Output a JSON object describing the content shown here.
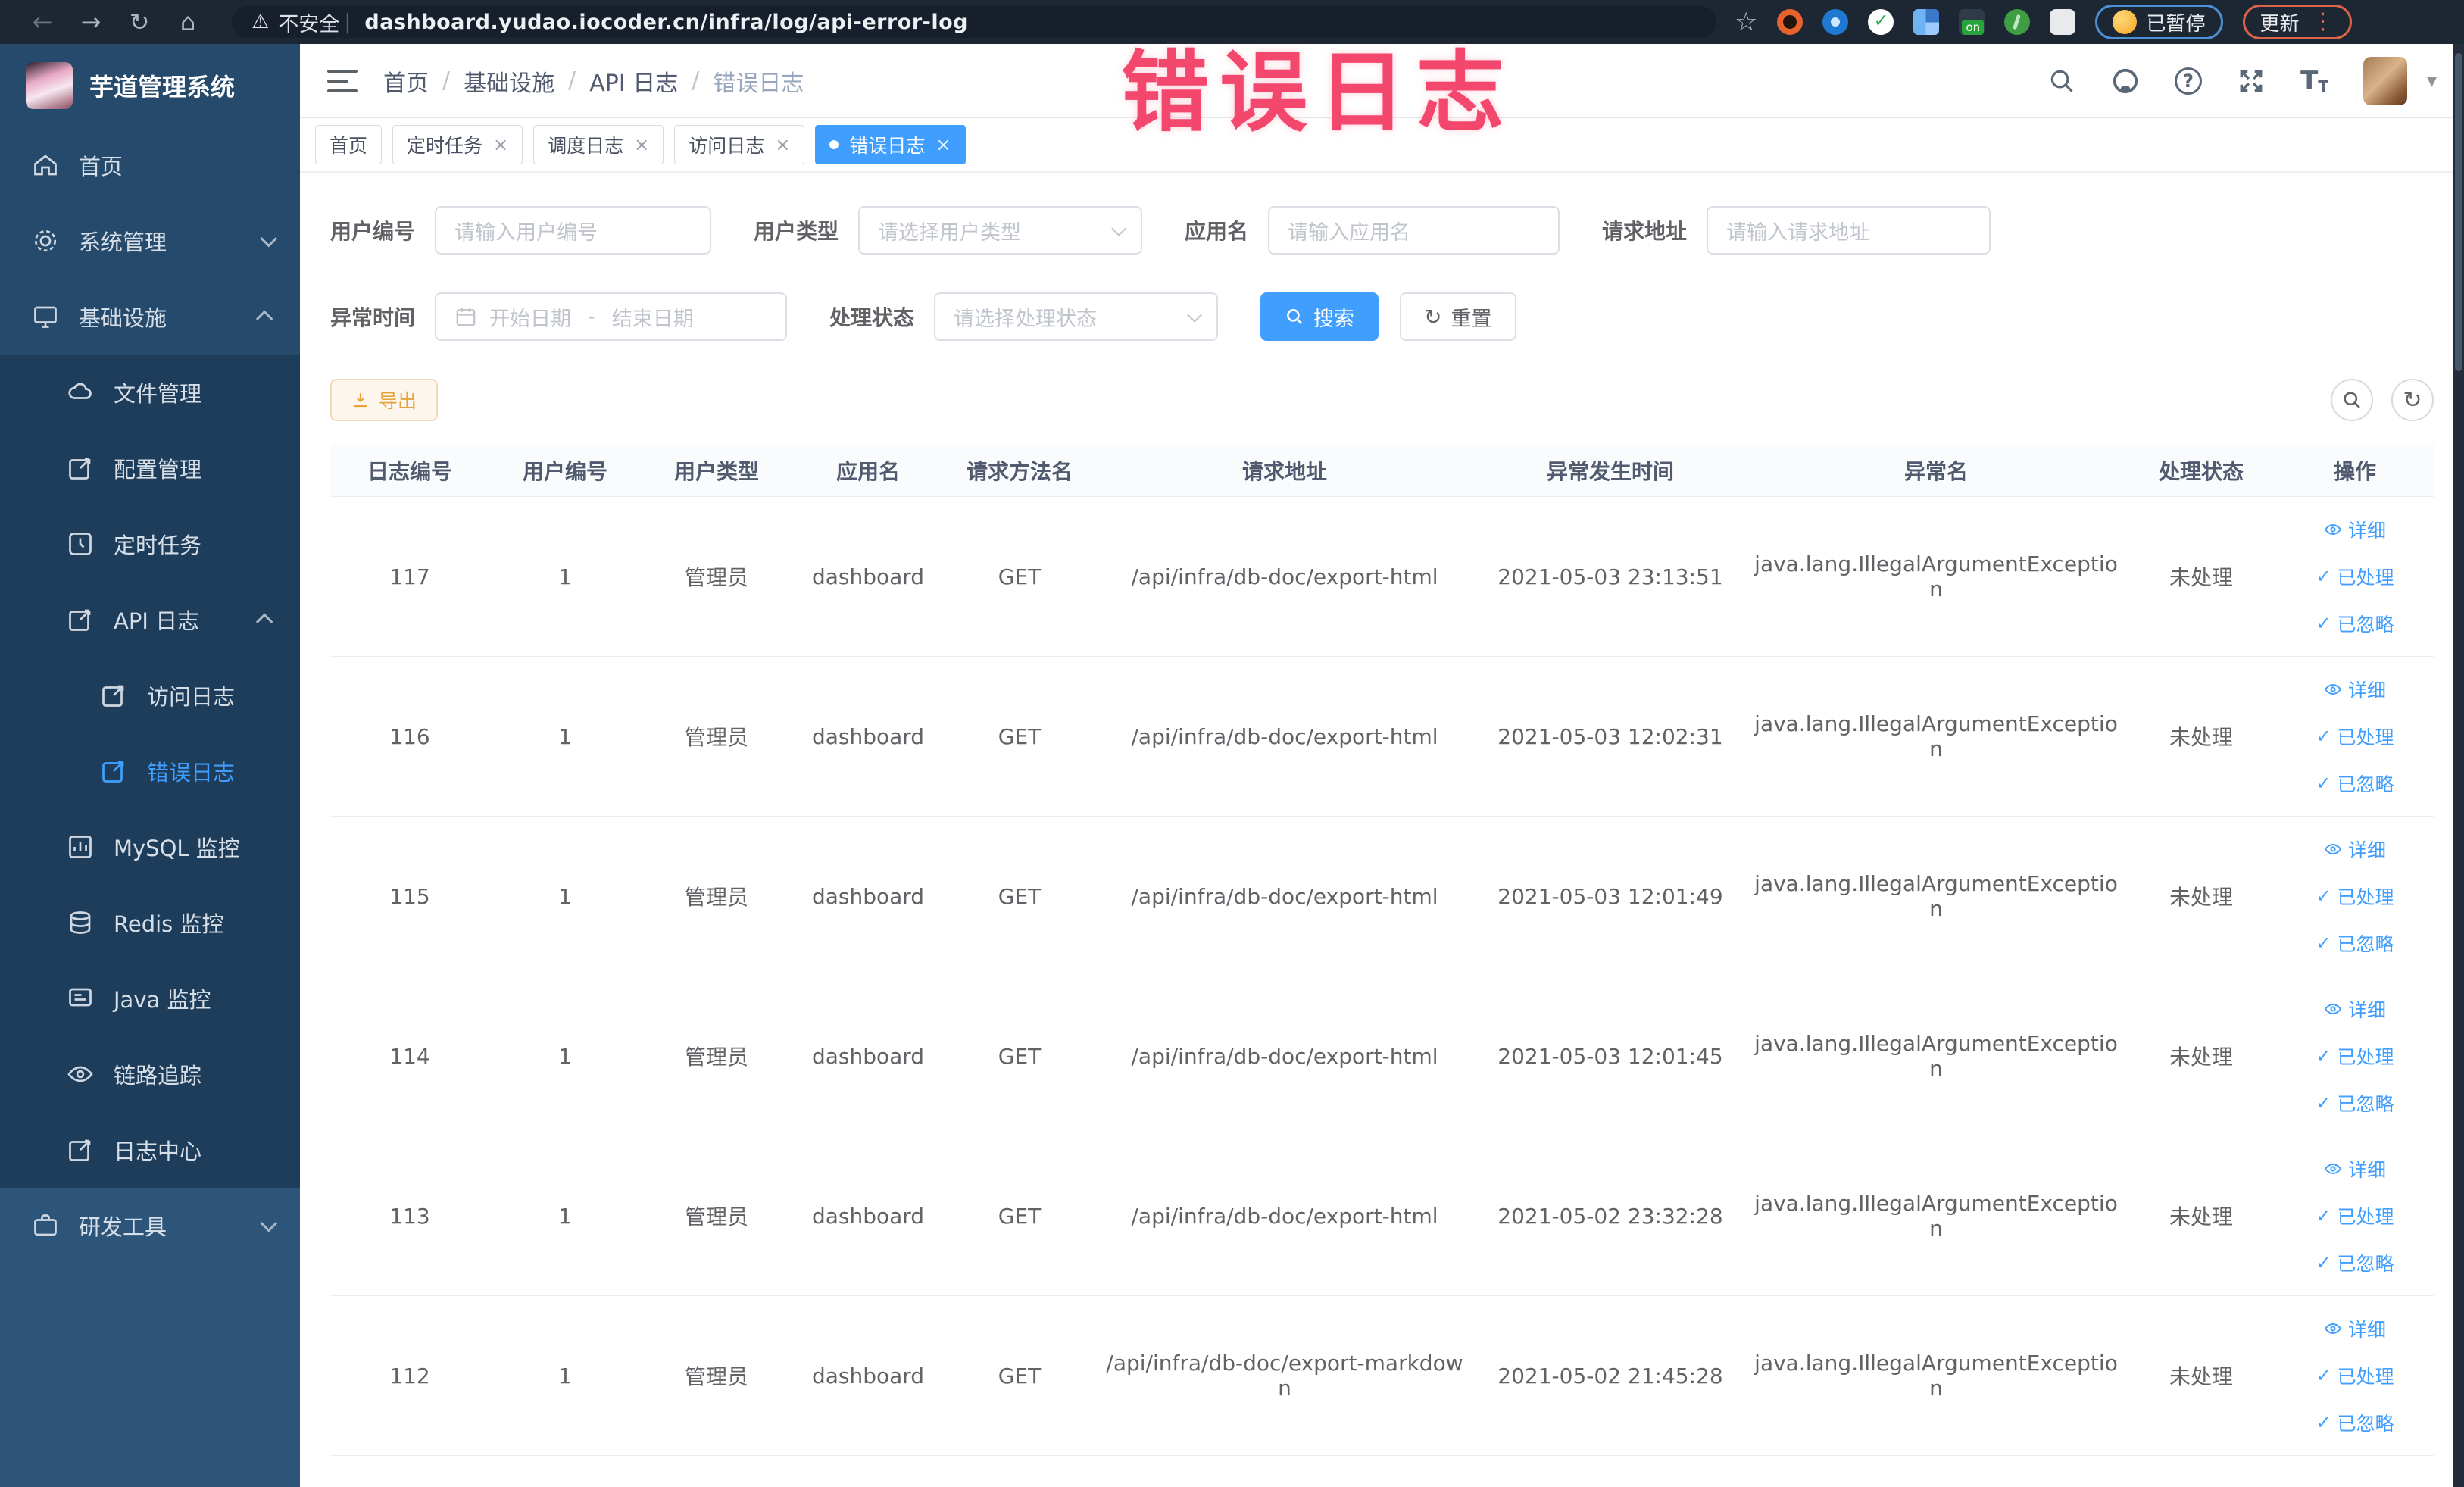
{
  "browser": {
    "security_warning": "不安全",
    "url": "dashboard.yudao.iocoder.cn/infra/log/api-error-log",
    "paused_badge": "已暂停",
    "update_button": "更新"
  },
  "annotation": {
    "text": "错误日志"
  },
  "sidebar": {
    "app_title": "芋道管理系统",
    "items": [
      {
        "label": "首页"
      },
      {
        "label": "系统管理"
      },
      {
        "label": "基础设施"
      },
      {
        "label": "文件管理"
      },
      {
        "label": "配置管理"
      },
      {
        "label": "定时任务"
      },
      {
        "label": "API 日志"
      },
      {
        "label": "访问日志"
      },
      {
        "label": "错误日志"
      },
      {
        "label": "MySQL 监控"
      },
      {
        "label": "Redis 监控"
      },
      {
        "label": "Java 监控"
      },
      {
        "label": "链路追踪"
      },
      {
        "label": "日志中心"
      },
      {
        "label": "研发工具"
      }
    ]
  },
  "breadcrumb": {
    "items": [
      "首页",
      "基础设施",
      "API 日志",
      "错误日志"
    ]
  },
  "tabs": [
    {
      "label": "首页"
    },
    {
      "label": "定时任务"
    },
    {
      "label": "调度日志"
    },
    {
      "label": "访问日志"
    },
    {
      "label": "错误日志"
    }
  ],
  "filters": {
    "user_id_label": "用户编号",
    "user_id_placeholder": "请输入用户编号",
    "user_type_label": "用户类型",
    "user_type_placeholder": "请选择用户类型",
    "app_name_label": "应用名",
    "app_name_placeholder": "请输入应用名",
    "request_url_label": "请求地址",
    "request_url_placeholder": "请输入请求地址",
    "exception_time_label": "异常时间",
    "date_start_placeholder": "开始日期",
    "date_separator": "-",
    "date_end_placeholder": "结束日期",
    "process_status_label": "处理状态",
    "process_status_placeholder": "请选择处理状态",
    "search_label": "搜索",
    "reset_label": "重置"
  },
  "toolbar": {
    "export_label": "导出"
  },
  "table": {
    "headers": [
      "日志编号",
      "用户编号",
      "用户类型",
      "应用名",
      "请求方法名",
      "请求地址",
      "异常发生时间",
      "异常名",
      "处理状态",
      "操作"
    ],
    "actions": {
      "detail": "详细",
      "processed": "已处理",
      "ignored": "已忽略"
    },
    "rows": [
      {
        "id": "117",
        "user_id": "1",
        "user_type": "管理员",
        "app": "dashboard",
        "method": "GET",
        "url": "/api/infra/db-doc/export-html",
        "time": "2021-05-03 23:13:51",
        "exception": "java.lang.IllegalArgumentException",
        "status": "未处理"
      },
      {
        "id": "116",
        "user_id": "1",
        "user_type": "管理员",
        "app": "dashboard",
        "method": "GET",
        "url": "/api/infra/db-doc/export-html",
        "time": "2021-05-03 12:02:31",
        "exception": "java.lang.IllegalArgumentException",
        "status": "未处理"
      },
      {
        "id": "115",
        "user_id": "1",
        "user_type": "管理员",
        "app": "dashboard",
        "method": "GET",
        "url": "/api/infra/db-doc/export-html",
        "time": "2021-05-03 12:01:49",
        "exception": "java.lang.IllegalArgumentException",
        "status": "未处理"
      },
      {
        "id": "114",
        "user_id": "1",
        "user_type": "管理员",
        "app": "dashboard",
        "method": "GET",
        "url": "/api/infra/db-doc/export-html",
        "time": "2021-05-03 12:01:45",
        "exception": "java.lang.IllegalArgumentException",
        "status": "未处理"
      },
      {
        "id": "113",
        "user_id": "1",
        "user_type": "管理员",
        "app": "dashboard",
        "method": "GET",
        "url": "/api/infra/db-doc/export-html",
        "time": "2021-05-02 23:32:28",
        "exception": "java.lang.IllegalArgumentException",
        "status": "未处理"
      },
      {
        "id": "112",
        "user_id": "1",
        "user_type": "管理员",
        "app": "dashboard",
        "method": "GET",
        "url": "/api/infra/db-doc/export-markdown",
        "time": "2021-05-02 21:45:28",
        "exception": "java.lang.IllegalArgumentException",
        "status": "未处理"
      }
    ]
  },
  "colors": {
    "accent": "#409eff",
    "warning": "#e6a23c",
    "annotation": "#f4476d",
    "sidebar_bg": "#264a6b"
  }
}
